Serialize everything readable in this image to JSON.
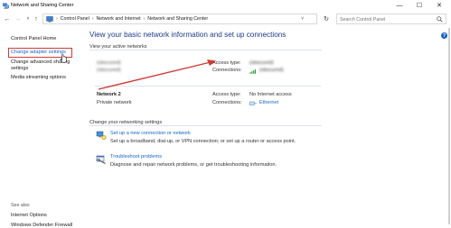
{
  "window": {
    "title": "Network and Sharing Center",
    "minimize": "—",
    "maximize": "☐",
    "close": "✕"
  },
  "nav": {
    "back": "←",
    "forward": "→",
    "recent": "˅",
    "up": "↑",
    "refresh": "↻",
    "address_dropdown": "˅"
  },
  "breadcrumbs": [
    "Control Panel",
    "Network and Internet",
    "Network and Sharing Center"
  ],
  "breadcrumb_separator": "›",
  "search": {
    "placeholder": "Search Control Panel"
  },
  "left_pane": {
    "home": "Control Panel Home",
    "change_adapter": "Change adapter settings",
    "change_advanced": "Change advanced sharing settings",
    "media": "Media streaming options",
    "see_also": "See also",
    "internet_options": "Internet Options",
    "firewall": "Windows Defender Firewall"
  },
  "main": {
    "title": "View your basic network information and set up connections",
    "active_networks_label": "View your active networks",
    "networks": [
      {
        "name": "(obscured)",
        "type": "(obscured)",
        "access_type_label": "Access type:",
        "access_type": "(obscured)",
        "connections_label": "Connections:",
        "connection": "(obscured)"
      },
      {
        "name": "Network 2",
        "type": "Private network",
        "access_type_label": "Access type:",
        "access_type": "No Internet access",
        "connections_label": "Connections:",
        "connection": "Ethernet"
      }
    ],
    "change_settings_label": "Change your networking settings",
    "tasks": [
      {
        "link": "Set up a new connection or network",
        "desc": "Set up a broadband, dial-up, or VPN connection; or set up a router or access point."
      },
      {
        "link": "Troubleshoot problems",
        "desc": "Diagnose and repair network problems, or get troubleshooting information."
      }
    ],
    "help": "?"
  },
  "colors": {
    "link": "#1664c4",
    "title": "#1e3a8a",
    "annotation": "#d23b35"
  },
  "icons": [
    "network-sharing-icon",
    "search-icon",
    "wifi-icon",
    "ethernet-icon",
    "new-connection-icon",
    "troubleshoot-icon",
    "hand-cursor-icon"
  ]
}
